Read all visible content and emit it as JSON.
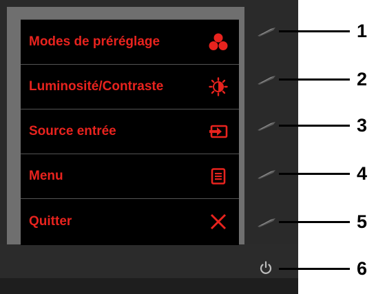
{
  "osd_menu": {
    "items": [
      {
        "label": "Modes de préréglage",
        "icon": "color-dots-icon"
      },
      {
        "label": "Luminosité/Contraste",
        "icon": "brightness-icon"
      },
      {
        "label": "Source entrée",
        "icon": "input-source-icon"
      },
      {
        "label": "Menu",
        "icon": "menu-list-icon"
      },
      {
        "label": "Quitter",
        "icon": "close-icon"
      }
    ]
  },
  "buttons": [
    {
      "number": "1",
      "type": "front-button"
    },
    {
      "number": "2",
      "type": "front-button"
    },
    {
      "number": "3",
      "type": "front-button"
    },
    {
      "number": "4",
      "type": "front-button"
    },
    {
      "number": "5",
      "type": "front-button"
    },
    {
      "number": "6",
      "type": "power-button"
    }
  ],
  "colors": {
    "osd_text": "#e8231e",
    "osd_background": "#000000",
    "bezel": "#2a2a2a",
    "screen": "#6f6f6f"
  }
}
